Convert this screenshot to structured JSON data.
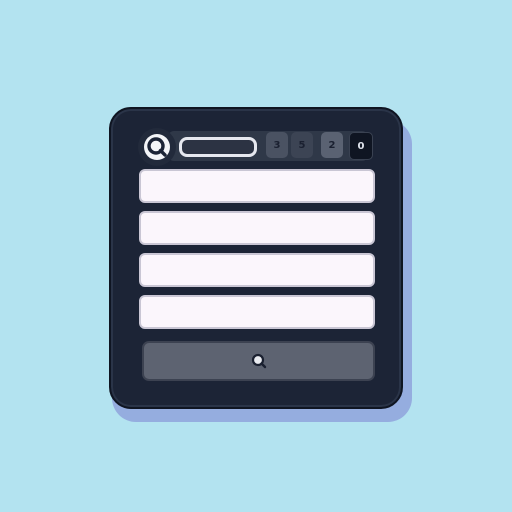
{
  "window": {
    "counters": [
      "3",
      "5",
      "2",
      "0"
    ]
  },
  "search": {
    "value": ""
  },
  "form": {
    "fields": [
      {
        "value": ""
      },
      {
        "value": ""
      },
      {
        "value": ""
      },
      {
        "value": ""
      }
    ]
  },
  "icons": {
    "logo": "search-icon",
    "action": "search-icon"
  },
  "colors": {
    "background": "#b3e3f0",
    "frame": "#1c2436",
    "field": "#fbf6fc",
    "button": "#5d6371"
  }
}
